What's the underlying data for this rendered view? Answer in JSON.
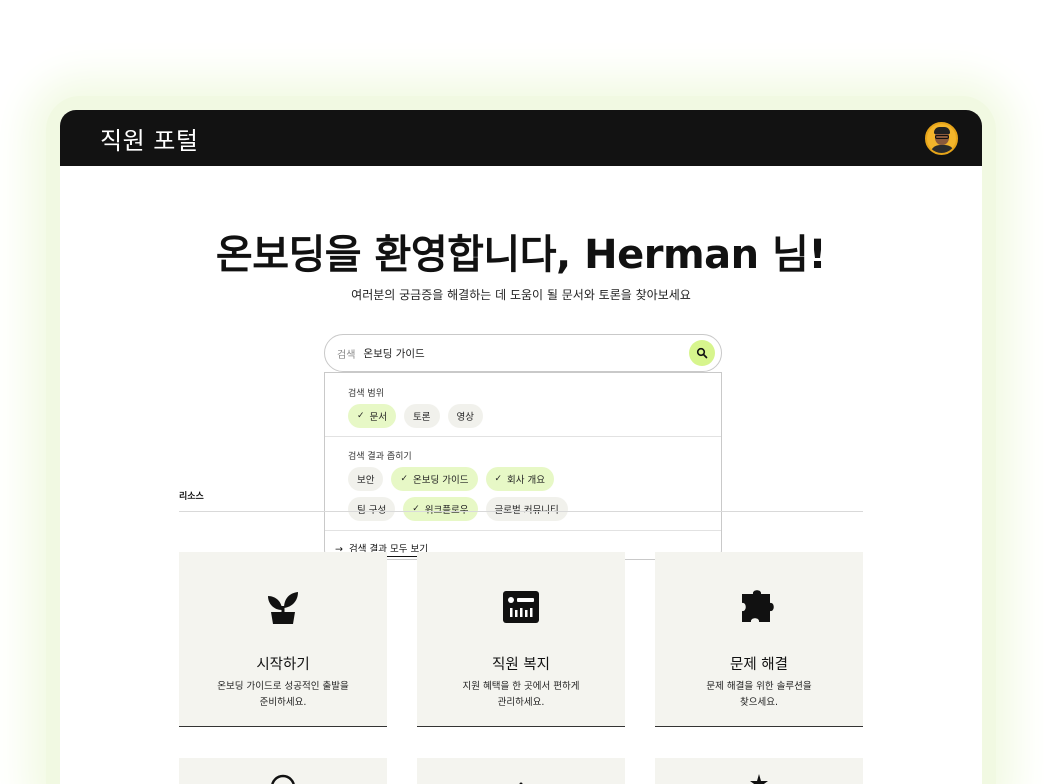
{
  "header": {
    "app_title": "직원 포털",
    "avatar_alt": "user avatar"
  },
  "hero": {
    "title": "온보딩을 환영합니다, Herman 님!",
    "subtitle": "여러분의 궁금증을 해결하는 데 도움이 될 문서와 토론을 찾아보세요"
  },
  "search": {
    "label": "검색",
    "value": "온보딩 가이드",
    "button_icon": "search-icon"
  },
  "dropdown": {
    "scope_title": "검색 범위",
    "scope_chips": [
      {
        "label": "문서",
        "selected": true
      },
      {
        "label": "토론",
        "selected": false
      },
      {
        "label": "영상",
        "selected": false
      }
    ],
    "filter_title": "검색 결과 좁히기",
    "filter_chips_row1": [
      {
        "label": "보안",
        "selected": false
      },
      {
        "label": "온보딩 가이드",
        "selected": true
      },
      {
        "label": "회사 개요",
        "selected": true
      }
    ],
    "filter_chips_row2": [
      {
        "label": "팀 구성",
        "selected": false
      },
      {
        "label": "워크플로우",
        "selected": true
      },
      {
        "label": "글로벌 커뮤니티",
        "selected": false
      }
    ],
    "see_all": "검색 결과 모두 보기",
    "check_glyph": "✓",
    "arrow_glyph": "→"
  },
  "resources": {
    "label": "리소스",
    "cards": [
      {
        "title": "시작하기",
        "desc_line1": "온보딩 가이드로 성공적인 출발을",
        "desc_line2": "준비하세요.",
        "icon": "sprout-icon"
      },
      {
        "title": "직원 복지",
        "desc_line1": "지원 혜택을 한 곳에서 편하게",
        "desc_line2": "관리하세요.",
        "icon": "benefits-card-icon"
      },
      {
        "title": "문제 해결",
        "desc_line1": "문제 해결을 위한 솔루션을",
        "desc_line2": "찾으세요.",
        "icon": "puzzle-icon"
      }
    ]
  },
  "colors": {
    "accent": "#d7f58d",
    "chip_selected": "#e7f8c6",
    "topbar": "#121212",
    "card_bg": "#f4f4ef"
  }
}
